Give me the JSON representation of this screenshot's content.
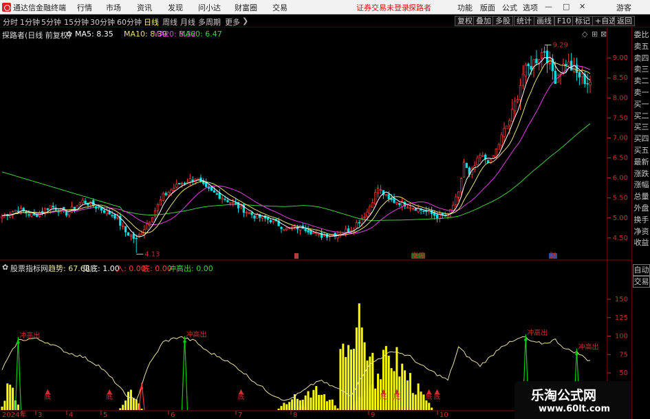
{
  "menubar": {
    "app_title": "通达信金融终端",
    "menu": [
      "行情",
      "市场",
      "资讯",
      "发现",
      "问小达",
      "财富圈",
      "交易"
    ],
    "warning": "证券交易未登录",
    "user": "探路者",
    "right_menu": [
      "功能",
      "版面",
      "公式",
      "选项"
    ],
    "guest": "游客"
  },
  "period_tabs": {
    "items": [
      "分时",
      "1分钟",
      "5分钟",
      "15分钟",
      "30分钟",
      "60分钟",
      "日线",
      "周线",
      "月线",
      "多周期",
      "更多"
    ],
    "active": "日线"
  },
  "right_tools": [
    "复权",
    "叠加",
    "多股",
    "统计",
    "画线",
    "F10",
    "标记",
    "+自选",
    "返回"
  ],
  "main_header": {
    "stock": "探路者(日线 前复权)",
    "ma5": "MA5: 8.35",
    "ma10": "MA10: 8.39",
    "ma20": "MA20: 8.32",
    "ma60": "MA60: 6.47"
  },
  "indicator_header": {
    "name": "股票指标网",
    "trend": "趋势: 67.68",
    "bottom": "见底: 1.00",
    "enter": "入: 0.00",
    "hold": "底: 0.00",
    "sell": "冲高出: 0.00"
  },
  "right_panel": {
    "items": [
      "委比",
      "卖五",
      "卖四",
      "卖三",
      "卖二",
      "卖一",
      "买一",
      "买二",
      "买三",
      "买四",
      "买五",
      "最新",
      "涨跌",
      "涨幅",
      "总量",
      "外盘",
      "换手",
      "净资",
      "收益"
    ],
    "buttons": [
      "自动",
      "交易"
    ]
  },
  "colors": {
    "up": "#ff3c3c",
    "down": "#00e0e0",
    "ma5": "#ffffff",
    "ma10": "#e8e070",
    "ma20": "#e040e0",
    "ma60": "#40d040",
    "trend": "#e8e0a0",
    "volume": "#ffff00",
    "axis": "#c83030",
    "signal": "#00d000"
  },
  "chart_data": [
    {
      "type": "candlestick",
      "title": "探路者(日线 前复权)",
      "y_axis_ticks": [
        4.5,
        5.0,
        5.5,
        6.0,
        6.5,
        7.0,
        7.5,
        8.0,
        8.5,
        9.0
      ],
      "ylim": [
        4.05,
        9.45
      ],
      "annotations": [
        {
          "text": "4.13",
          "value": 4.13
        },
        {
          "text": "9.29",
          "value": 9.29
        }
      ],
      "markers": [
        "s",
        "涨停",
        "财"
      ],
      "series": [
        {
          "name": "MA5",
          "value": "8.35"
        },
        {
          "name": "MA10",
          "value": "8.39"
        },
        {
          "name": "MA20",
          "value": "8.32"
        },
        {
          "name": "MA60",
          "value": "6.47"
        }
      ],
      "keypoints": [
        [
          0,
          5.05
        ],
        [
          6,
          5.22
        ],
        [
          12,
          5.05
        ],
        [
          18,
          5.3
        ],
        [
          24,
          5.12
        ],
        [
          30,
          5.42
        ],
        [
          36,
          5.25
        ],
        [
          42,
          5.05
        ],
        [
          46,
          4.65
        ],
        [
          50,
          4.45
        ],
        [
          55,
          4.95
        ],
        [
          60,
          5.55
        ],
        [
          66,
          5.85
        ],
        [
          72,
          6.0
        ],
        [
          76,
          5.72
        ],
        [
          82,
          5.52
        ],
        [
          88,
          5.28
        ],
        [
          94,
          5.05
        ],
        [
          100,
          4.95
        ],
        [
          106,
          4.72
        ],
        [
          112,
          4.78
        ],
        [
          118,
          4.55
        ],
        [
          124,
          4.6
        ],
        [
          130,
          4.72
        ],
        [
          136,
          5.15
        ],
        [
          140,
          5.75
        ],
        [
          144,
          5.45
        ],
        [
          150,
          5.35
        ],
        [
          156,
          5.2
        ],
        [
          162,
          5.05
        ],
        [
          166,
          5.05
        ],
        [
          170,
          5.6
        ],
        [
          172,
          6.4
        ],
        [
          174,
          6.05
        ],
        [
          178,
          6.55
        ],
        [
          182,
          6.4
        ],
        [
          186,
          7.0
        ],
        [
          190,
          7.6
        ],
        [
          194,
          8.6
        ],
        [
          198,
          8.9
        ],
        [
          202,
          9.2
        ],
        [
          206,
          8.5
        ],
        [
          210,
          8.9
        ],
        [
          214,
          8.6
        ],
        [
          218,
          8.4
        ]
      ]
    },
    {
      "type": "indicator",
      "name": "股票指标网",
      "y_axis_ticks": [
        50,
        75,
        100,
        125,
        150
      ],
      "trend_value": 67.68,
      "labels": [
        "冲高出",
        "冲高出",
        "冲高出",
        "冲高出"
      ],
      "bottom_marker": "底",
      "date_axis": [
        "2024年",
        "3",
        "4",
        "5",
        "6",
        "7",
        "8",
        "9",
        "10"
      ],
      "trend_keypoints": [
        [
          0,
          55
        ],
        [
          6,
          94
        ],
        [
          12,
          97
        ],
        [
          18,
          90
        ],
        [
          24,
          78
        ],
        [
          30,
          72
        ],
        [
          36,
          60
        ],
        [
          42,
          38
        ],
        [
          46,
          20
        ],
        [
          50,
          12
        ],
        [
          54,
          56
        ],
        [
          60,
          92
        ],
        [
          66,
          99
        ],
        [
          72,
          93
        ],
        [
          76,
          80
        ],
        [
          82,
          70
        ],
        [
          88,
          56
        ],
        [
          94,
          38
        ],
        [
          100,
          22
        ],
        [
          106,
          12
        ],
        [
          112,
          25
        ],
        [
          118,
          40
        ],
        [
          124,
          30
        ],
        [
          130,
          20
        ],
        [
          136,
          58
        ],
        [
          140,
          69
        ],
        [
          146,
          80
        ],
        [
          152,
          72
        ],
        [
          156,
          60
        ],
        [
          162,
          48
        ],
        [
          166,
          40
        ],
        [
          170,
          85
        ],
        [
          174,
          70
        ],
        [
          178,
          60
        ],
        [
          182,
          72
        ],
        [
          186,
          87
        ],
        [
          190,
          92
        ],
        [
          194,
          99
        ],
        [
          198,
          91
        ],
        [
          202,
          90
        ],
        [
          206,
          95
        ],
        [
          210,
          82
        ],
        [
          214,
          78
        ],
        [
          218,
          68
        ]
      ]
    }
  ]
}
